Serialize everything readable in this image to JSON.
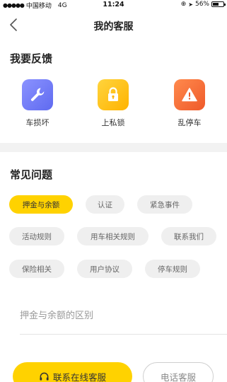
{
  "status_bar": {
    "carrier": "中国移动",
    "network": "4G",
    "time": "11:24",
    "battery": "56%",
    "battery_level": 0.56
  },
  "nav": {
    "title": "我的客服"
  },
  "feedback": {
    "title": "我要反馈",
    "items": [
      {
        "label": "车损坏",
        "icon": "wrench-icon",
        "color": "#6f79f5"
      },
      {
        "label": "上私锁",
        "icon": "lock-icon",
        "color": "#ffc21a"
      },
      {
        "label": "乱停车",
        "icon": "warning-icon",
        "color": "#f7743d"
      }
    ]
  },
  "faq": {
    "title": "常见问题",
    "tags": [
      "押金与余额",
      "认证",
      "紧急事件",
      "活动规则",
      "用车相关规则",
      "联系我们",
      "保险相关",
      "用户协议",
      "停车规则"
    ],
    "selected_tag": "押金与余额",
    "questions": [
      "押金与余额的区别"
    ]
  },
  "actions": {
    "online_label": "联系在线客服",
    "phone_label": "电话客服"
  },
  "colors": {
    "accent": "#ffd200",
    "chip_bg": "#efefef"
  }
}
